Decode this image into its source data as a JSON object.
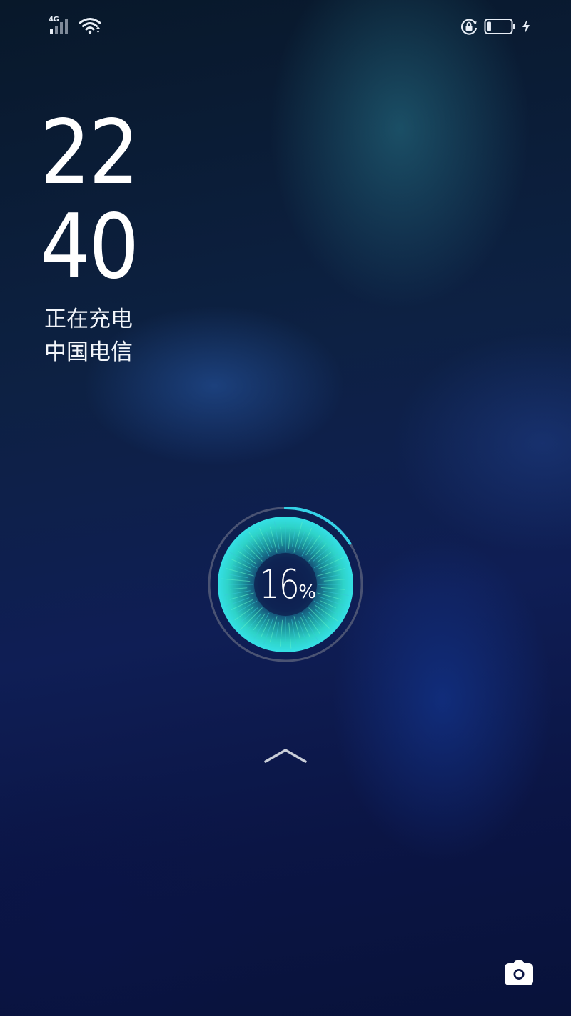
{
  "status_bar": {
    "network_type": "4G",
    "signal_icon": "signal-strength-icon",
    "wifi_icon": "wifi-icon",
    "rotation_lock_icon": "rotation-lock-icon",
    "battery_icon": "battery-icon",
    "charging_icon": "charging-bolt-icon",
    "battery_level": 0.16
  },
  "lock_screen": {
    "clock_hours": "22",
    "clock_minutes": "40",
    "charging_status": "正在充电",
    "carrier": "中国电信"
  },
  "charging_indicator": {
    "percent_value": "16",
    "percent_unit": "%",
    "progress_fraction": 0.16,
    "accent_color": "#35d3e8",
    "ring_track_color": "#4a5373"
  },
  "swipe_hint_icon": "chevron-up-icon",
  "camera_shortcut_icon": "camera-icon"
}
